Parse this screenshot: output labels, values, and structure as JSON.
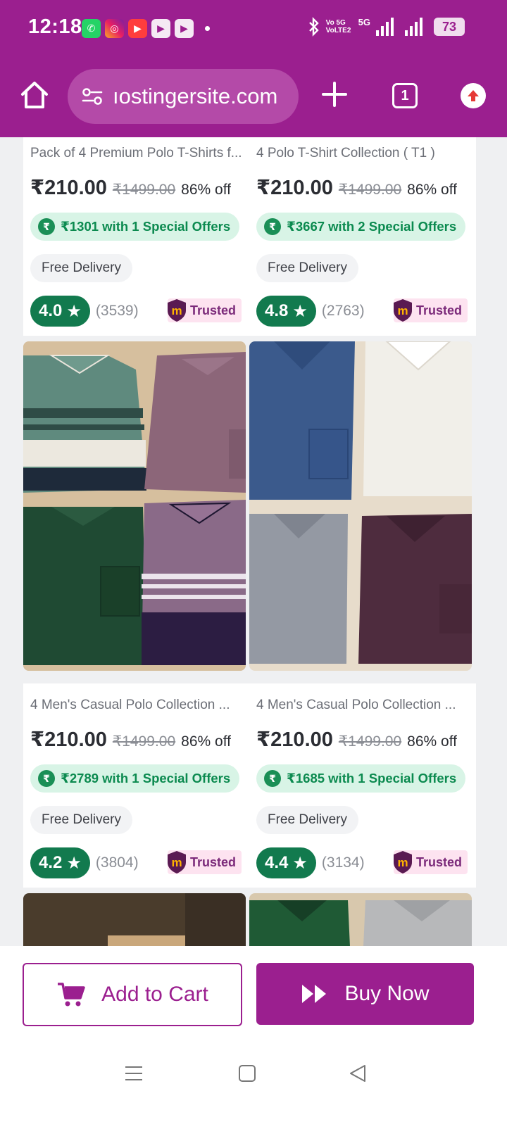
{
  "status_bar": {
    "time": "12:18",
    "network_label": "Vo 5G VoLTE2",
    "network_5g": "5G",
    "battery": "73"
  },
  "browser": {
    "url": "ıostingersite.com",
    "tab_count": "1"
  },
  "colors": {
    "brand": "#9b1f8f",
    "offer_bg": "#d8f4e6",
    "offer_text": "#0b8a4f",
    "rating_bg": "#127a4e"
  },
  "products": [
    {
      "title": "Pack of 4 Premium Polo T-Shirts f...",
      "price": "₹210.00",
      "mrp": "₹1499.00",
      "discount": "86% off",
      "offer": "₹1301 with 1 Special Offers",
      "delivery": "Free Delivery",
      "rating": "4.0",
      "reviews": "(3539)",
      "badge": "Trusted"
    },
    {
      "title": "4 Polo T-Shirt Collection ( T1 )",
      "price": "₹210.00",
      "mrp": "₹1499.00",
      "discount": "86% off",
      "offer": "₹3667 with 2 Special Offers",
      "delivery": "Free Delivery",
      "rating": "4.8",
      "reviews": "(2763)",
      "badge": "Trusted"
    },
    {
      "title": "4 Men's Casual Polo Collection ...",
      "price": "₹210.00",
      "mrp": "₹1499.00",
      "discount": "86% off",
      "offer": "₹2789 with 1 Special Offers",
      "delivery": "Free Delivery",
      "rating": "4.2",
      "reviews": "(3804)",
      "badge": "Trusted"
    },
    {
      "title": "4 Men's Casual Polo Collection ...",
      "price": "₹210.00",
      "mrp": "₹1499.00",
      "discount": "86% off",
      "offer": "₹1685 with 1 Special Offers",
      "delivery": "Free Delivery",
      "rating": "4.4",
      "reviews": "(3134)",
      "badge": "Trusted"
    }
  ],
  "actions": {
    "add_to_cart": "Add to Cart",
    "buy_now": "Buy Now"
  }
}
